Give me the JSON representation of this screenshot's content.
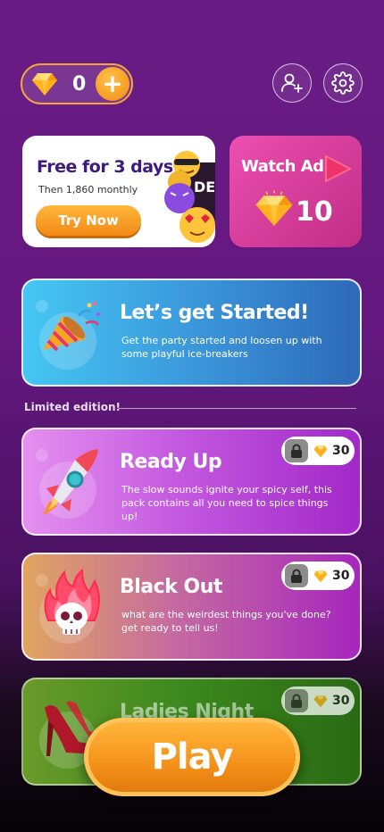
{
  "wallet": {
    "gem_count": "0",
    "plus_label": "+"
  },
  "promo": {
    "title": "Free for 3 days",
    "subtitle": "Then 1,860 monthly",
    "button": "Try Now",
    "badge_text": "DE SI"
  },
  "watch_ad": {
    "title": "Watch Ad",
    "reward": "10"
  },
  "packs": [
    {
      "title": "Let’s get Started!",
      "description": "Get the party started and loosen up with some playful ice-breakers",
      "icon": "party-popper-icon"
    },
    {
      "title": "Ready Up",
      "description": "The slow sounds ignite your spicy self, this pack contains all you need to spice things up!",
      "price": "30",
      "icon": "rocket-icon"
    },
    {
      "title": "Black Out",
      "description": "what are the weirdest things you've done? get ready to tell us!",
      "price": "30",
      "icon": "flaming-skull-icon"
    },
    {
      "title": "Ladies Night",
      "description": "",
      "price": "30",
      "icon": "high-heel-icon"
    }
  ],
  "section": {
    "label": "Limited edition!"
  },
  "play": {
    "label": "Play"
  },
  "colors": {
    "accent": "#f5921a",
    "background": "#6a1c86",
    "promo_title": "#3d1a80",
    "watch_card": "#d63a9a"
  }
}
